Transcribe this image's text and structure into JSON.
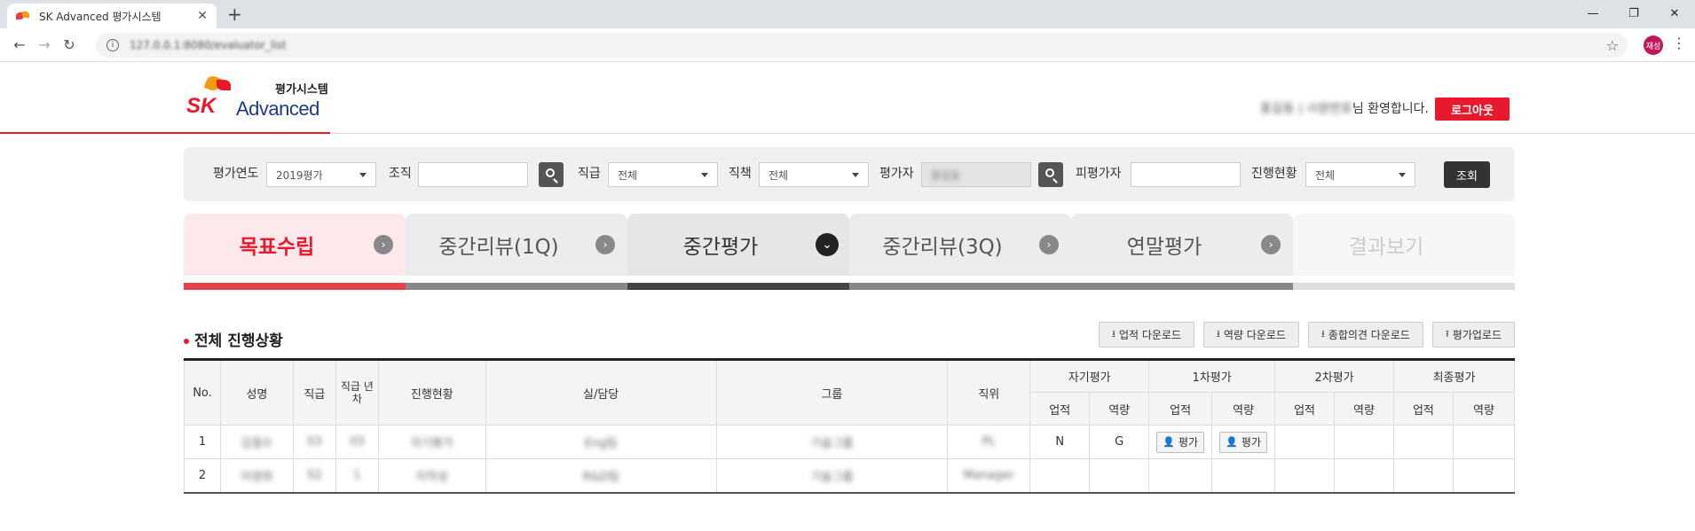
{
  "browser": {
    "tab_title": "SK Advanced 평가시스템",
    "url": "127.0.0.1:8080/evaluator_list",
    "profile_label": "재성"
  },
  "header": {
    "logo_brand": "SK",
    "logo_product": "Advanced",
    "logo_subtitle": "평가시스템",
    "welcome_name": "홍길동 | 사원번호",
    "welcome_suffix": "님 환영합니다.",
    "logout_label": "로그아웃"
  },
  "search": {
    "year_label": "평가연도",
    "year_value": "2019평가",
    "org_label": "조직",
    "org_value": "",
    "grade_label": "직급",
    "grade_value": "전체",
    "duty_label": "직책",
    "duty_value": "전체",
    "evaluator_label": "평가자",
    "evaluator_value": "홍길동",
    "evaluatee_label": "피평가자",
    "evaluatee_value": "",
    "status_label": "진행현황",
    "status_value": "전체",
    "query_label": "조회"
  },
  "steps": [
    {
      "label": "목표수립",
      "state": "done"
    },
    {
      "label": "중간리뷰(1Q)",
      "state": "done"
    },
    {
      "label": "중간평가",
      "state": "current"
    },
    {
      "label": "중간리뷰(3Q)",
      "state": "pending"
    },
    {
      "label": "연말평가",
      "state": "pending"
    },
    {
      "label": "결과보기",
      "state": "disabled"
    }
  ],
  "section": {
    "title": "전체 진행상황",
    "buttons": [
      "업적 다운로드",
      "역량 다운로드",
      "종합의견 다운로드",
      "평가업로드"
    ]
  },
  "table": {
    "headers": {
      "no": "No.",
      "name": "성명",
      "grade": "직급",
      "grade_years": "직급 년차",
      "status": "진행현황",
      "dept": "실/담당",
      "group": "그룹",
      "position": "직위",
      "self_eval": "자기평가",
      "first_eval": "1차평가",
      "second_eval": "2차평가",
      "final_eval": "최종평가",
      "perf": "업적",
      "comp": "역량"
    },
    "rows": [
      {
        "no": "1",
        "name": "김철수",
        "grade": "S3",
        "years": "03",
        "status": "자기평가",
        "dept": "Eng팀",
        "group": "기술그룹",
        "position": "PL",
        "self_perf": "N",
        "self_comp": "G",
        "first_perf_btn": "평가",
        "first_comp_btn": "평가"
      },
      {
        "no": "2",
        "name": "이영희",
        "grade": "S2",
        "years": "1",
        "status": "미작성",
        "dept": "R&D팀",
        "group": "기술그룹",
        "position": "Manager",
        "self_perf": "",
        "self_comp": ""
      }
    ]
  }
}
